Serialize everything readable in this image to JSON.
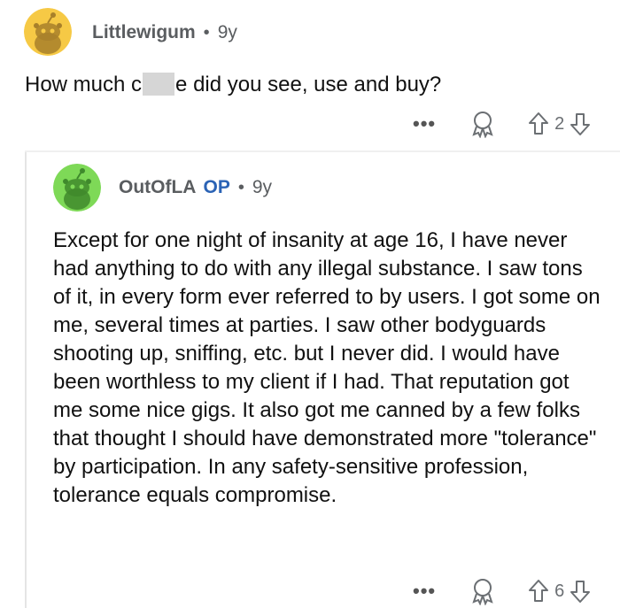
{
  "comments": [
    {
      "username": "Littlewigum",
      "age": "9y",
      "text_before": "How much c",
      "text_after": "e did you see, use and buy?",
      "score": "2",
      "avatar_color": "#f6c945"
    },
    {
      "username": "OutOfLA",
      "op_label": "OP",
      "age": "9y",
      "text": "Except for one night of insanity at age 16, I have never had anything to do with any illegal substance. I saw tons of it, in every form ever referred to by users. I got some on me, several times at parties. I saw other bodyguards shooting up, sniffing, etc. but I never did. I would have been worthless to my client if I had. That reputation got me some nice gigs. It also got me canned by a few folks that thought I should have demonstrated more \"tolerance\" by participation. In any safety-sensitive profession, tolerance equals compromise.",
      "score": "6",
      "avatar_color": "#7ed957"
    }
  ],
  "icons": {
    "more": "more-options-icon",
    "award": "award-icon",
    "upvote": "upvote-arrow-icon",
    "downvote": "downvote-arrow-icon"
  },
  "more_glyph": "•••"
}
